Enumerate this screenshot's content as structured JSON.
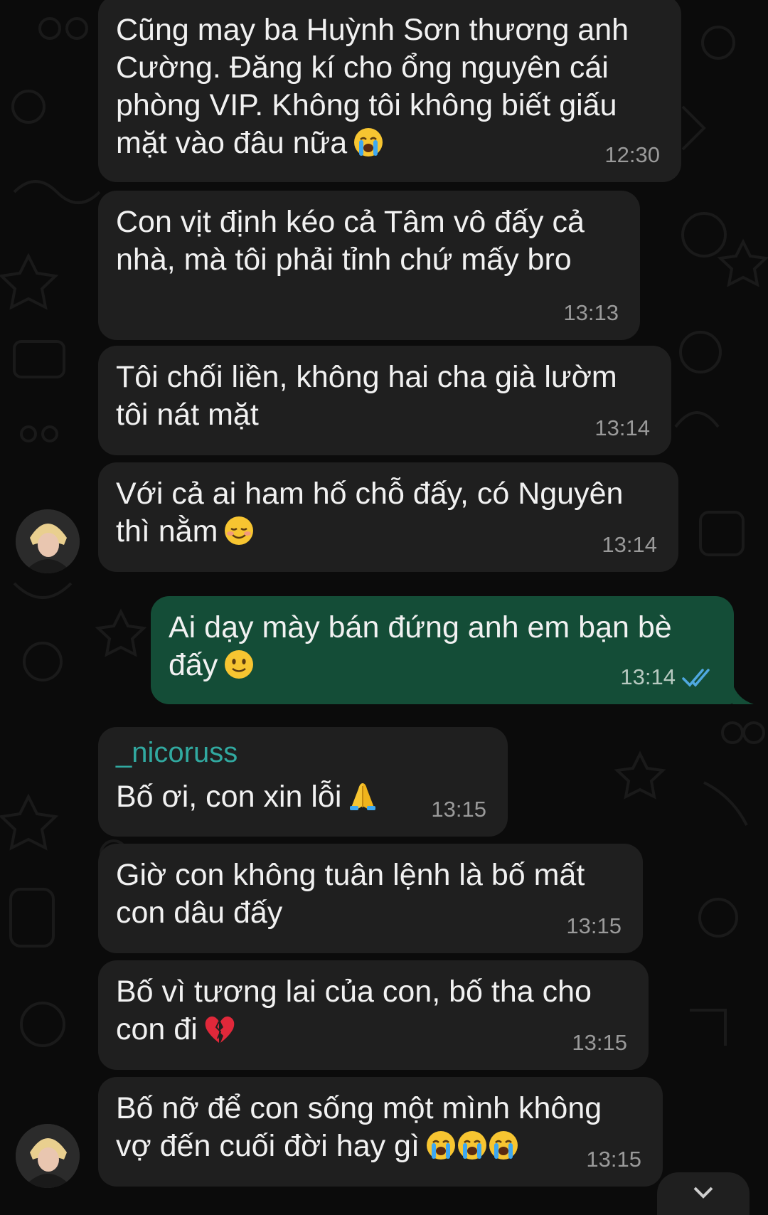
{
  "colors": {
    "incoming_bubble": "#1f1f1f",
    "outgoing_bubble": "#144d37",
    "sender_name": "#31a9a0",
    "read_ticks": "#4fa8e0",
    "timestamp": "#9a9a9a"
  },
  "messages": [
    {
      "direction": "incoming",
      "text": "Cũng may ba Huỳnh Sơn thương anh\nCường. Đăng kí cho ổng nguyên cái\nphòng VIP. Không tôi không biết giấu\nmặt vào đâu nữa",
      "emoji": [
        "loudly-crying-face"
      ],
      "time": "12:30"
    },
    {
      "direction": "incoming",
      "text": "Con vịt định kéo cả Tâm vô đấy cả\nnhà, mà tôi phải tỉnh chứ mấy bro",
      "time": "13:13"
    },
    {
      "direction": "incoming",
      "text": "Tôi chối liền, không hai cha già lườm\ntôi nát mặt",
      "time": "13:14"
    },
    {
      "direction": "incoming",
      "text": "Với cả ai ham hố chỗ đấy, có Nguyên\nthì nằm",
      "emoji": [
        "smiling-face"
      ],
      "time": "13:14"
    },
    {
      "direction": "outgoing",
      "text": "Ai dạy mày bán đứng anh em bạn bè\nđấy",
      "emoji": [
        "slightly-smiling-face"
      ],
      "time": "13:14",
      "status": "read-double-check"
    },
    {
      "direction": "incoming",
      "sender": "_nicoruss",
      "text": "Bố ơi, con xin lỗi",
      "emoji": [
        "folded-hands"
      ],
      "time": "13:15"
    },
    {
      "direction": "incoming",
      "text": "Giờ con không tuân lệnh là bố mất\ncon dâu đấy",
      "time": "13:15"
    },
    {
      "direction": "incoming",
      "text": "Bố vì tương lai của con, bố tha cho\ncon đi",
      "emoji": [
        "broken-heart"
      ],
      "time": "13:15"
    },
    {
      "direction": "incoming",
      "text": "Bố nỡ để con sống một mình không\nvợ đến cuối đời hay gì",
      "emoji": [
        "loudly-crying-face",
        "loudly-crying-face",
        "loudly-crying-face"
      ],
      "time": "13:15"
    }
  ]
}
